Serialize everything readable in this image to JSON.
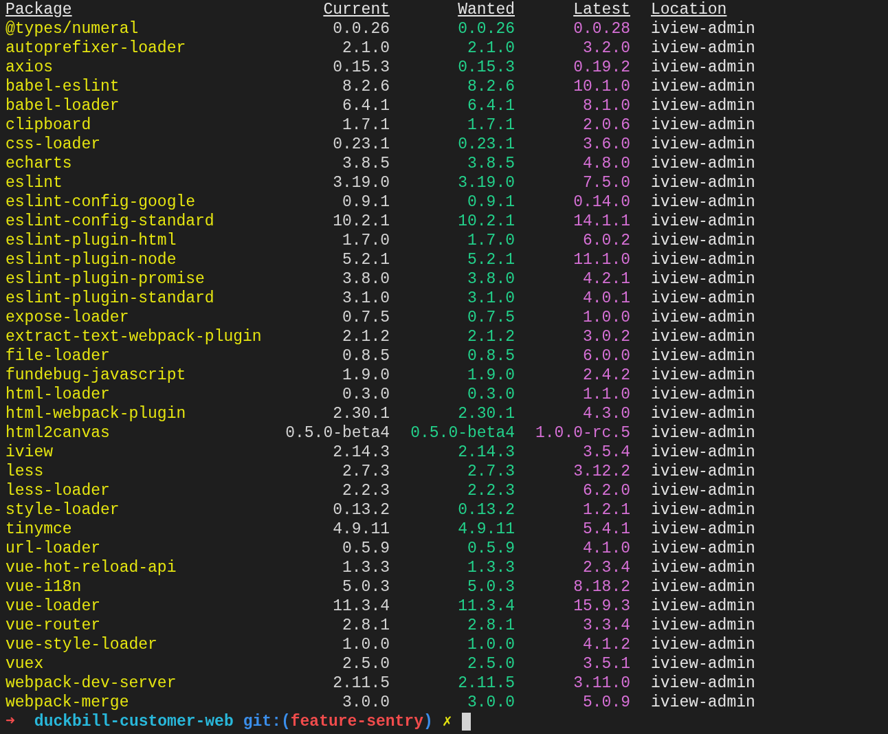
{
  "table": {
    "columns": [
      "Package",
      "Current",
      "Wanted",
      "Latest",
      "Location"
    ],
    "rows": [
      [
        "@types/numeral",
        "0.0.26",
        "0.0.26",
        "0.0.28",
        "iview-admin"
      ],
      [
        "autoprefixer-loader",
        "2.1.0",
        "2.1.0",
        "3.2.0",
        "iview-admin"
      ],
      [
        "axios",
        "0.15.3",
        "0.15.3",
        "0.19.2",
        "iview-admin"
      ],
      [
        "babel-eslint",
        "8.2.6",
        "8.2.6",
        "10.1.0",
        "iview-admin"
      ],
      [
        "babel-loader",
        "6.4.1",
        "6.4.1",
        "8.1.0",
        "iview-admin"
      ],
      [
        "clipboard",
        "1.7.1",
        "1.7.1",
        "2.0.6",
        "iview-admin"
      ],
      [
        "css-loader",
        "0.23.1",
        "0.23.1",
        "3.6.0",
        "iview-admin"
      ],
      [
        "echarts",
        "3.8.5",
        "3.8.5",
        "4.8.0",
        "iview-admin"
      ],
      [
        "eslint",
        "3.19.0",
        "3.19.0",
        "7.5.0",
        "iview-admin"
      ],
      [
        "eslint-config-google",
        "0.9.1",
        "0.9.1",
        "0.14.0",
        "iview-admin"
      ],
      [
        "eslint-config-standard",
        "10.2.1",
        "10.2.1",
        "14.1.1",
        "iview-admin"
      ],
      [
        "eslint-plugin-html",
        "1.7.0",
        "1.7.0",
        "6.0.2",
        "iview-admin"
      ],
      [
        "eslint-plugin-node",
        "5.2.1",
        "5.2.1",
        "11.1.0",
        "iview-admin"
      ],
      [
        "eslint-plugin-promise",
        "3.8.0",
        "3.8.0",
        "4.2.1",
        "iview-admin"
      ],
      [
        "eslint-plugin-standard",
        "3.1.0",
        "3.1.0",
        "4.0.1",
        "iview-admin"
      ],
      [
        "expose-loader",
        "0.7.5",
        "0.7.5",
        "1.0.0",
        "iview-admin"
      ],
      [
        "extract-text-webpack-plugin",
        "2.1.2",
        "2.1.2",
        "3.0.2",
        "iview-admin"
      ],
      [
        "file-loader",
        "0.8.5",
        "0.8.5",
        "6.0.0",
        "iview-admin"
      ],
      [
        "fundebug-javascript",
        "1.9.0",
        "1.9.0",
        "2.4.2",
        "iview-admin"
      ],
      [
        "html-loader",
        "0.3.0",
        "0.3.0",
        "1.1.0",
        "iview-admin"
      ],
      [
        "html-webpack-plugin",
        "2.30.1",
        "2.30.1",
        "4.3.0",
        "iview-admin"
      ],
      [
        "html2canvas",
        "0.5.0-beta4",
        "0.5.0-beta4",
        "1.0.0-rc.5",
        "iview-admin"
      ],
      [
        "iview",
        "2.14.3",
        "2.14.3",
        "3.5.4",
        "iview-admin"
      ],
      [
        "less",
        "2.7.3",
        "2.7.3",
        "3.12.2",
        "iview-admin"
      ],
      [
        "less-loader",
        "2.2.3",
        "2.2.3",
        "6.2.0",
        "iview-admin"
      ],
      [
        "style-loader",
        "0.13.2",
        "0.13.2",
        "1.2.1",
        "iview-admin"
      ],
      [
        "tinymce",
        "4.9.11",
        "4.9.11",
        "5.4.1",
        "iview-admin"
      ],
      [
        "url-loader",
        "0.5.9",
        "0.5.9",
        "4.1.0",
        "iview-admin"
      ],
      [
        "vue-hot-reload-api",
        "1.3.3",
        "1.3.3",
        "2.3.4",
        "iview-admin"
      ],
      [
        "vue-i18n",
        "5.0.3",
        "5.0.3",
        "8.18.2",
        "iview-admin"
      ],
      [
        "vue-loader",
        "11.3.4",
        "11.3.4",
        "15.9.3",
        "iview-admin"
      ],
      [
        "vue-router",
        "2.8.1",
        "2.8.1",
        "3.3.4",
        "iview-admin"
      ],
      [
        "vue-style-loader",
        "1.0.0",
        "1.0.0",
        "4.1.2",
        "iview-admin"
      ],
      [
        "vuex",
        "2.5.0",
        "2.5.0",
        "3.5.1",
        "iview-admin"
      ],
      [
        "webpack-dev-server",
        "2.11.5",
        "2.11.5",
        "3.11.0",
        "iview-admin"
      ],
      [
        "webpack-merge",
        "3.0.0",
        "3.0.0",
        "5.0.9",
        "iview-admin"
      ]
    ]
  },
  "prompt": {
    "arrow": "➜",
    "directory": "duckbill-customer-web",
    "git_label": "git:(",
    "branch": "feature-sentry",
    "git_close": ")",
    "dirty": "✗"
  }
}
